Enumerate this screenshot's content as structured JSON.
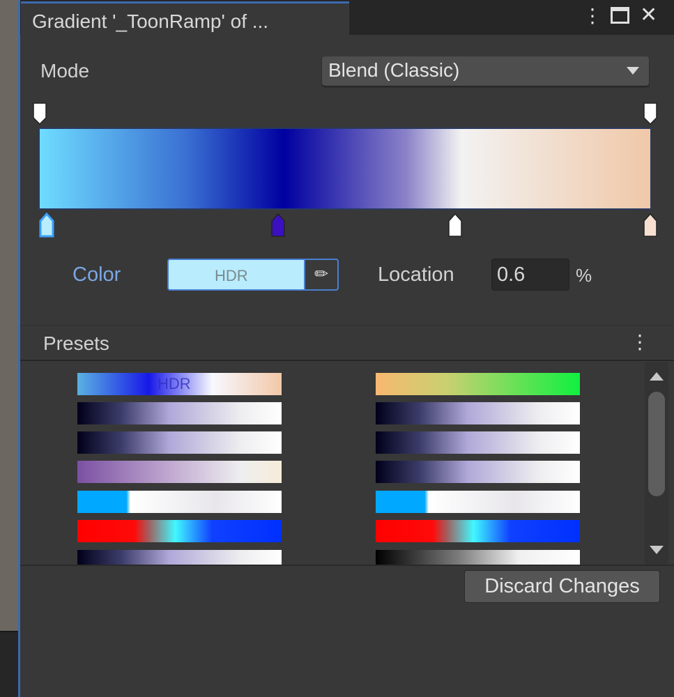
{
  "window": {
    "tab_title": "Gradient '_ToonRamp' of ...",
    "menu_icon": "kebab-menu-icon",
    "maximize_icon": "maximize-icon",
    "close_icon": "close-icon"
  },
  "mode": {
    "label": "Mode",
    "value": "Blend (Classic)"
  },
  "gradient": {
    "css": "linear-gradient(90deg,#6fdcff 0%,#3a70d2 24%,#0000a0 40%,#8a82c8 60%,#f2f2f2 69%,#f0c8a8 100%)",
    "alpha_keys": [
      {
        "location": 0,
        "color": "#ffffff"
      },
      {
        "location": 100,
        "color": "#ffffff"
      }
    ],
    "color_keys": [
      {
        "location": 0.6,
        "color": "#b9ecfc",
        "selected": true
      },
      {
        "location": 39,
        "color": "#3a10c0"
      },
      {
        "location": 68,
        "color": "#ffffff"
      },
      {
        "location": 100,
        "color": "#f8e0d0"
      }
    ]
  },
  "selected_key": {
    "color_label": "Color",
    "color_value": "#b9ecfc",
    "hdr_text": "HDR",
    "eyedropper_icon": "eyedropper-icon",
    "location_label": "Location",
    "location_value": "0.6",
    "percent": "%"
  },
  "presets": {
    "label": "Presets",
    "items": [
      {
        "css": "linear-gradient(90deg,#5ab2e2,#1818e8 35%,#f8f8ff 66%,#f2c8a8)",
        "text": "HDR"
      },
      {
        "css": "linear-gradient(90deg,#f8b870,#c8d070 35%,#10f040)"
      },
      {
        "css": "linear-gradient(90deg,#00001a,#3e3e6c 22%,#b0a8d8 45%,#eeeef0 80%,#fff)"
      },
      {
        "css": "linear-gradient(90deg,#00001a,#3e3e6c 22%,#b0a8d8 45%,#eeeef0 80%,#fff)"
      },
      {
        "css": "linear-gradient(90deg,#00001a,#3e3e6c 22%,#b0a8d8 45%,#eeeef0 80%,#fff)"
      },
      {
        "css": "linear-gradient(90deg,#00001a,#3e3e6c 22%,#b0a8d8 45%,#eeeef0 80%,#fff)"
      },
      {
        "css": "linear-gradient(90deg,#7a50a2,#c0a8d0 45%,#eeeef0 80%,#f6ecd8)"
      },
      {
        "css": "linear-gradient(90deg,#00001a,#3e3e6c 22%,#b0a8d8 45%,#eeeef0 80%,#fff)"
      },
      {
        "css": "linear-gradient(90deg,#00a8ff 0%,#00a8ff 24%,#fff 26%,#f4f4f6 45%,#e8e6ea 68%,#fff)"
      },
      {
        "css": "linear-gradient(90deg,#00a8ff 0%,#00a8ff 24%,#fff 26%,#f4f4f6 45%,#e8e6ea 68%,#fff)"
      },
      {
        "css": "linear-gradient(90deg,#ff0000 0%,#ff0a0a 28%,#a06060 35%,#40f8ff 48%,#1040ff 66%,#0030ff)"
      },
      {
        "css": "linear-gradient(90deg,#ff0000 0%,#ff0a0a 28%,#a06060 35%,#40f8ff 48%,#1040ff 66%,#0030ff)"
      },
      {
        "css": "linear-gradient(90deg,#00001a,#3e3e6c 22%,#b0a8d8 45%,#eeeef0 80%,#fff)"
      },
      {
        "css": "linear-gradient(90deg,#000,#7a7a7a 40%,#f0f0f0 70%,#fff)"
      }
    ]
  },
  "discard_label": "Discard Changes"
}
